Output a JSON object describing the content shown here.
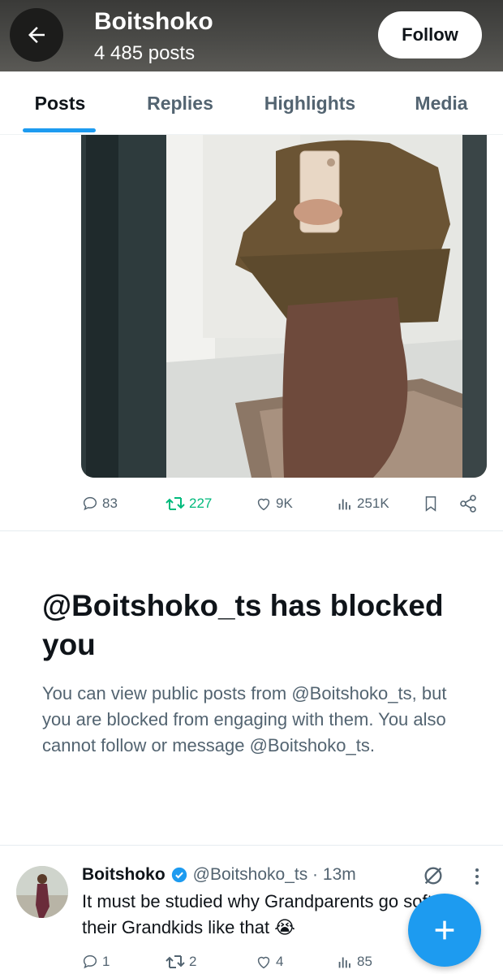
{
  "header": {
    "name": "Boitshoko",
    "posts_count": "4 485 posts",
    "follow_label": "Follow"
  },
  "tabs": [
    {
      "label": "Posts",
      "active": true
    },
    {
      "label": "Replies",
      "active": false
    },
    {
      "label": "Highlights",
      "active": false
    },
    {
      "label": "Media",
      "active": false
    }
  ],
  "media_post": {
    "stats": {
      "replies": "83",
      "reposts": "227",
      "likes": "9K",
      "views": "251K"
    }
  },
  "blocked_notice": {
    "title": "@Boitshoko_ts has blocked you",
    "body": "You can view public posts from @Boitshoko_ts, but you are blocked from engaging with them. You also cannot follow or message @Boitshoko_ts."
  },
  "tweet": {
    "name": "Boitshoko",
    "handle_time": "@Boitshoko_ts · 13m",
    "text": "It must be studied why Grandparents go soft on their Grandkids like that 😭",
    "stats": {
      "replies": "1",
      "reposts": "2",
      "likes": "4",
      "views": "85"
    }
  },
  "colors": {
    "accent": "#1d9bf0",
    "repost_active": "#00ba7c",
    "secondary_text": "#536471",
    "verified_badge": "#1d9bf0"
  },
  "icons": [
    "back-arrow-icon",
    "reply-icon",
    "repost-icon",
    "like-icon",
    "views-icon",
    "bookmark-icon",
    "share-icon",
    "verified-icon",
    "grok-icon",
    "more-icon",
    "plus-icon"
  ]
}
